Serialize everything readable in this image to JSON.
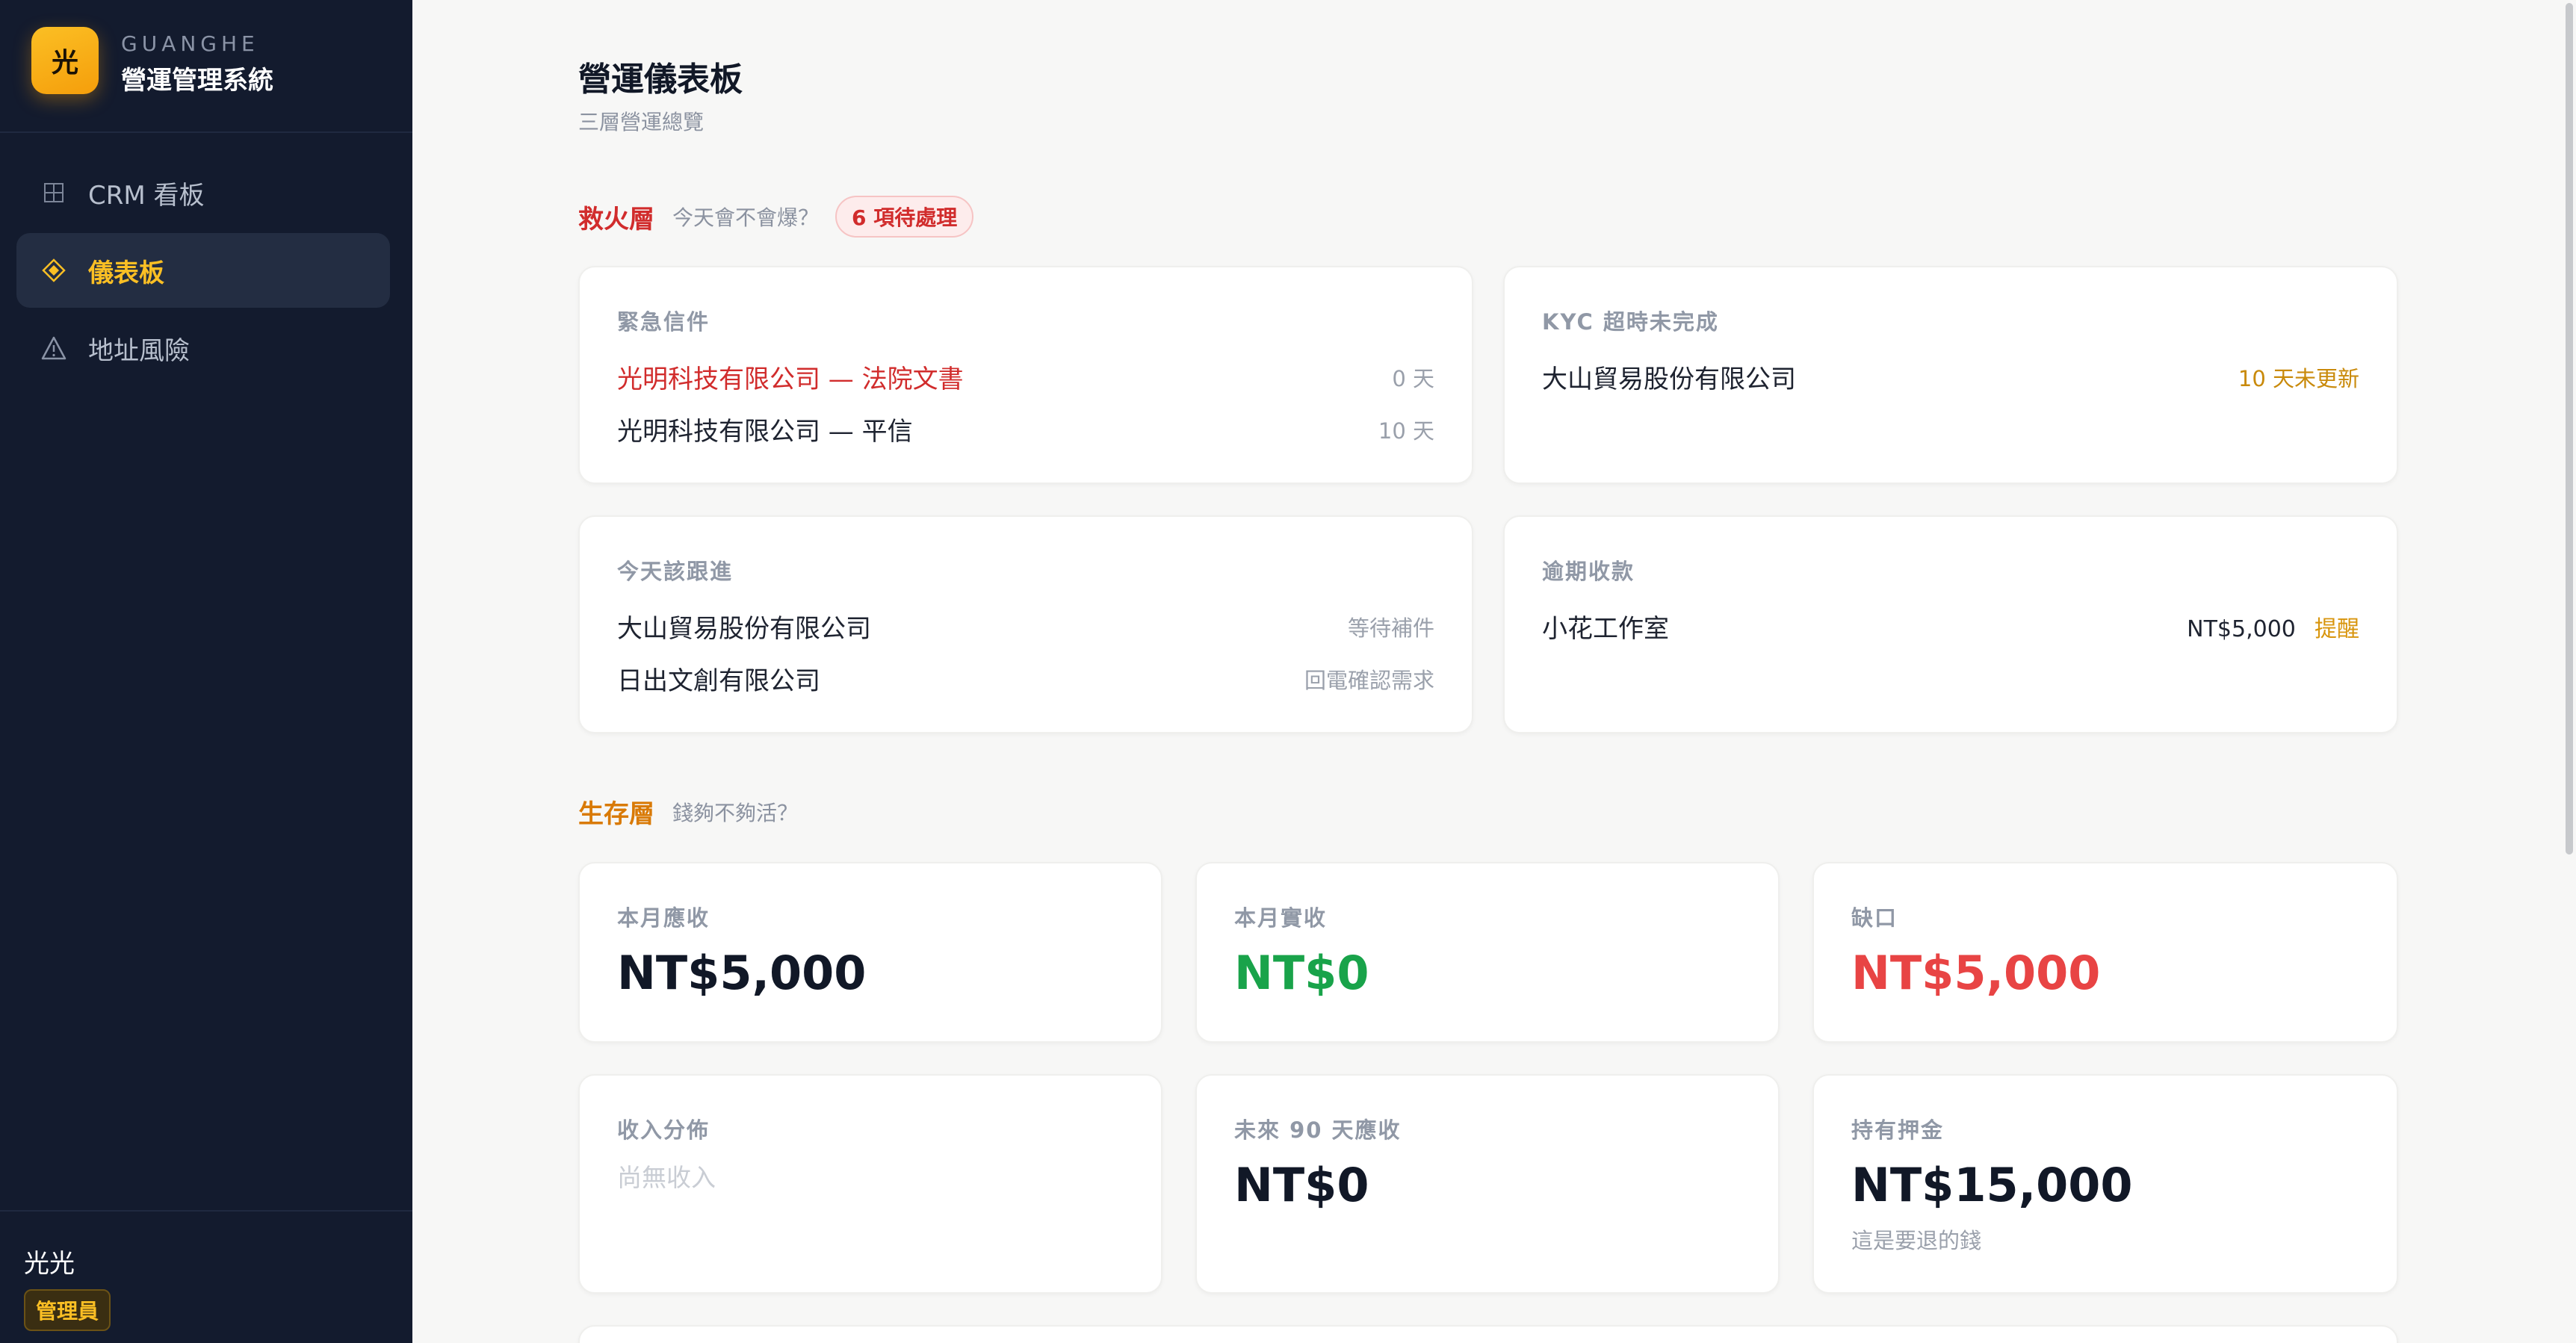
{
  "brand": {
    "logo_char": "光",
    "en": "GUANGHE",
    "zh": "營運管理系統"
  },
  "nav": {
    "items": [
      {
        "label": "CRM 看板",
        "icon": "grid-icon"
      },
      {
        "label": "儀表板",
        "icon": "diamond-icon"
      },
      {
        "label": "地址風險",
        "icon": "warning-icon"
      }
    ]
  },
  "user": {
    "name": "光光",
    "role": "管理員"
  },
  "page": {
    "title": "營運儀表板",
    "subtitle": "三層營運總覽"
  },
  "firefight": {
    "title": "救火層",
    "question": "今天會不會爆？",
    "badge": "6 項待處理",
    "urgent_mail": {
      "title": "緊急信件",
      "rows": [
        {
          "label": "光明科技有限公司 — 法院文書",
          "value": "0 天"
        },
        {
          "label": "光明科技有限公司 — 平信",
          "value": "10 天"
        }
      ]
    },
    "kyc": {
      "title": "KYC 超時未完成",
      "rows": [
        {
          "label": "大山貿易股份有限公司",
          "value": "10 天未更新"
        }
      ]
    },
    "followup": {
      "title": "今天該跟進",
      "rows": [
        {
          "label": "大山貿易股份有限公司",
          "value": "等待補件"
        },
        {
          "label": "日出文創有限公司",
          "value": "回電確認需求"
        }
      ]
    },
    "overdue": {
      "title": "逾期收款",
      "rows": [
        {
          "label": "小花工作室",
          "amount": "NT$5,000",
          "action": "提醒"
        }
      ]
    }
  },
  "survival": {
    "title": "生存層",
    "question": "錢夠不夠活？",
    "receivable": {
      "title": "本月應收",
      "value": "NT$5,000"
    },
    "received": {
      "title": "本月實收",
      "value": "NT$0"
    },
    "gap": {
      "title": "缺口",
      "value": "NT$5,000"
    },
    "distribution": {
      "title": "收入分佈",
      "empty": "尚無收入"
    },
    "next90": {
      "title": "未來 90 天應收",
      "value": "NT$0"
    },
    "deposit": {
      "title": "持有押金",
      "value": "NT$15,000",
      "note": "這是要退的錢"
    }
  },
  "colors": {
    "sidebar_bg": "#131b2e",
    "accent": "#fbbf24",
    "firefight": "#d12c2c",
    "survival": "#d97a06",
    "positive": "#19a34a",
    "negative": "#e84444"
  }
}
